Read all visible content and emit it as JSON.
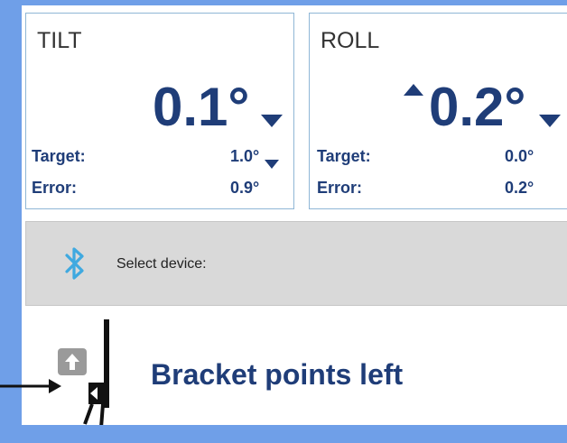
{
  "tilt": {
    "title": "TILT",
    "value": "0.1°",
    "target_label": "Target:",
    "target_value": "1.0°",
    "error_label": "Error:",
    "error_value": "0.9°"
  },
  "roll": {
    "title": "ROLL",
    "value": "0.2°",
    "target_label": "Target:",
    "target_value": "0.0°",
    "error_label": "Error:",
    "error_value": "0.2°"
  },
  "device": {
    "label": "Select device:",
    "icon": "bluetooth-icon"
  },
  "orientation": {
    "label": "Bracket points left",
    "icon": "bracket-orientation-icon"
  },
  "colors": {
    "background": "#6f9fe8",
    "primary_text": "#1f3d78",
    "card_border": "#8fb6d6",
    "device_bar": "#d9d9d9",
    "bluetooth": "#3fa9e0"
  }
}
